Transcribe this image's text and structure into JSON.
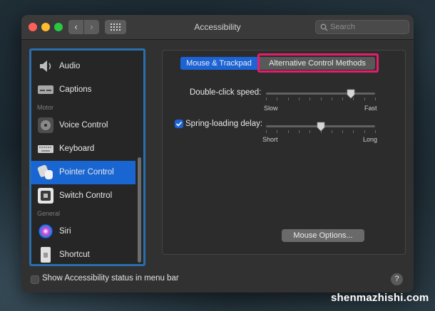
{
  "window": {
    "title": "Accessibility"
  },
  "search": {
    "placeholder": "Search"
  },
  "sidebar": {
    "items": [
      {
        "label": "Audio",
        "icon": "speaker-icon"
      },
      {
        "label": "Captions",
        "icon": "captions-icon"
      },
      {
        "section": "Motor"
      },
      {
        "label": "Voice Control",
        "icon": "voice-control-icon"
      },
      {
        "label": "Keyboard",
        "icon": "keyboard-icon"
      },
      {
        "label": "Pointer Control",
        "icon": "pointer-control-icon",
        "selected": true
      },
      {
        "label": "Switch Control",
        "icon": "switch-control-icon"
      },
      {
        "section": "General"
      },
      {
        "label": "Siri",
        "icon": "siri-icon"
      },
      {
        "label": "Shortcut",
        "icon": "shortcut-icon"
      }
    ]
  },
  "tabs": [
    {
      "label": "Mouse & Trackpad",
      "active": true
    },
    {
      "label": "Alternative Control Methods",
      "active": false
    }
  ],
  "double_click": {
    "label": "Double-click speed:",
    "min_label": "Slow",
    "max_label": "Fast",
    "value_fraction": 0.78
  },
  "spring_loading": {
    "label": "Spring-loading delay:",
    "checked": true,
    "min_label": "Short",
    "max_label": "Long",
    "value_fraction": 0.5
  },
  "buttons": {
    "mouse_options": "Mouse Options..."
  },
  "footer": {
    "status_label": "Show Accessibility status in menu bar",
    "status_checked": false,
    "help": "?"
  },
  "watermark": "shenmazhishi.com",
  "colors": {
    "accent": "#1c64d6",
    "highlight": "#e71c6c",
    "selection_border": "#2a6fad"
  }
}
